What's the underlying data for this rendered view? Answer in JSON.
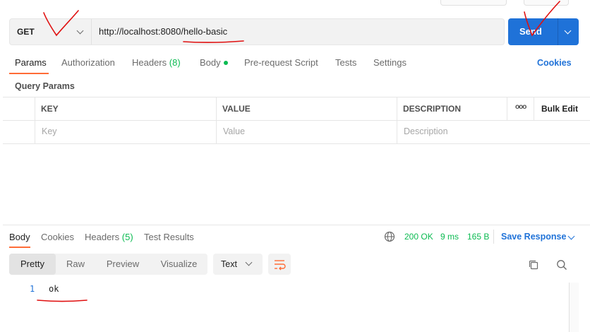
{
  "request": {
    "method": "GET",
    "url": "http://localhost:8080/hello-basic",
    "send_label": "Send"
  },
  "request_tabs": [
    {
      "label": "Params",
      "active": true
    },
    {
      "label": "Authorization"
    },
    {
      "label": "Headers",
      "count": "(8)"
    },
    {
      "label": "Body"
    },
    {
      "label": "Pre-request Script"
    },
    {
      "label": "Tests"
    },
    {
      "label": "Settings"
    }
  ],
  "cookies_link": "Cookies",
  "query_params": {
    "title": "Query Params",
    "columns": [
      "KEY",
      "VALUE",
      "DESCRIPTION"
    ],
    "more_label": "ooo",
    "bulk_edit": "Bulk Edit",
    "placeholders": [
      "Key",
      "Value",
      "Description"
    ]
  },
  "response": {
    "tabs": [
      {
        "label": "Body",
        "active": true
      },
      {
        "label": "Cookies"
      },
      {
        "label": "Headers",
        "count": "(5)"
      },
      {
        "label": "Test Results"
      }
    ],
    "status": "200 OK",
    "time": "9 ms",
    "size": "165 B",
    "save_label": "Save Response",
    "view_modes": [
      "Pretty",
      "Raw",
      "Preview",
      "Visualize"
    ],
    "format": "Text",
    "lines": [
      {
        "num": "1",
        "text": "ok"
      }
    ]
  },
  "colors": {
    "accent": "#ff6c37",
    "send": "#1f72d8",
    "status_ok": "#0cbb52",
    "annotation": "#e01010"
  },
  "icons": [
    "chevron-down-icon",
    "globe-icon",
    "wrap-lines-icon",
    "copy-icon",
    "search-icon"
  ]
}
